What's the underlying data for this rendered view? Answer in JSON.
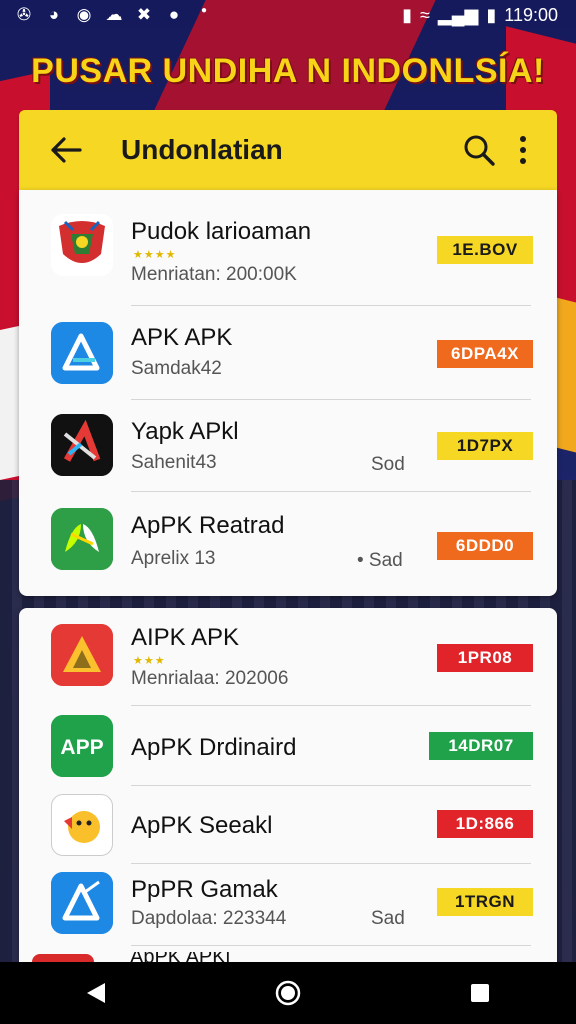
{
  "status_bar": {
    "left_icons": [
      "sim-icon",
      "messenger-icon",
      "chrome-icon",
      "weibo-icon",
      "media-icon",
      "photos-icon",
      "dot-icon"
    ],
    "time": "119:00"
  },
  "banner": {
    "text": "PUSAR UNDIHA N INDONLSÍA!"
  },
  "app_bar": {
    "title": "Undonlatian"
  },
  "colors": {
    "yellow": "#f5d724",
    "orange": "#f06a1e",
    "red": "#e0242a",
    "green": "#1fa24a"
  },
  "list": [
    {
      "name": "Pudok larioaman",
      "stars": "★★★★",
      "sub": "Menriatan: 200:00K",
      "note": "",
      "badge": "1E.BOV",
      "badge_color": "yellow",
      "icon": "emblem-icon"
    },
    {
      "name": "APK APK",
      "stars": "",
      "sub": "Samdak42",
      "note": "",
      "badge": "6DPA4X",
      "badge_color": "orange",
      "icon": "apk-installer-icon"
    },
    {
      "name": "Yapk APkl",
      "stars": "",
      "sub": "Sahenit43",
      "note": "Sod",
      "badge": "1D7PX",
      "badge_color": "yellow",
      "icon": "red-x-app-icon"
    },
    {
      "name": "ApPK Reatrad",
      "stars": "",
      "sub": "Aprelix 13",
      "note": "• Sad",
      "badge": "6DDD0",
      "badge_color": "orange",
      "icon": "green-leaf-app-icon"
    },
    {
      "name": "AIPK APK",
      "stars": "★★★",
      "sub": "Menrialaa: 202006",
      "note": "",
      "badge": "1PR08",
      "badge_color": "red",
      "icon": "triangle-app-icon"
    },
    {
      "name": "ApPK Drdinaird",
      "stars": "",
      "sub": "",
      "note": "",
      "badge": "14DR07",
      "badge_color": "green",
      "icon": "app-text-icon"
    },
    {
      "name": "ApPK Seeakl",
      "stars": "",
      "sub": "",
      "note": "",
      "badge": "1D:866",
      "badge_color": "red",
      "icon": "emoji-app-icon"
    },
    {
      "name": "PpPR Gamak",
      "stars": "",
      "sub": "Dapdolaa: 223344",
      "note": "Sad",
      "badge": "1TRGN",
      "badge_color": "yellow",
      "icon": "blue-installer-icon"
    }
  ],
  "peek_item": {
    "name": "ApPK APKl"
  },
  "nav_bar": {
    "buttons": [
      "back-nav-icon",
      "home-nav-icon",
      "recents-nav-icon"
    ]
  }
}
